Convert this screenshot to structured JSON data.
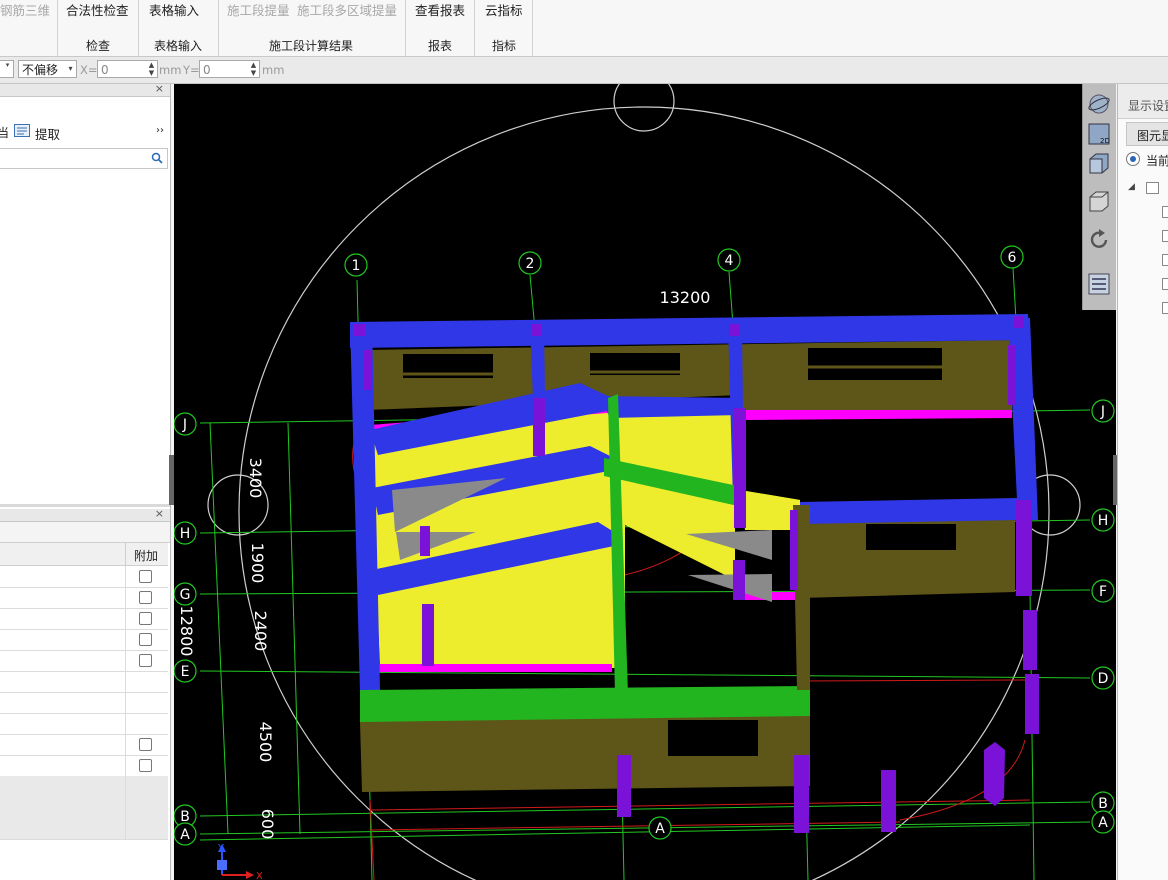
{
  "ribbon": {
    "cut_left": "钢筋三维",
    "groups": [
      {
        "buttons": [
          "合法性检查"
        ],
        "label": "检查"
      },
      {
        "buttons": [
          "表格输入"
        ],
        "label": "表格输入"
      },
      {
        "buttons": [
          "施工段提量",
          "施工段多区域提量"
        ],
        "label": "施工段计算结果"
      },
      {
        "buttons": [
          "查看报表"
        ],
        "label": "报表"
      },
      {
        "buttons": [
          "云指标"
        ],
        "label": "指标"
      }
    ]
  },
  "toolbar": {
    "offset_select": "不偏移",
    "x_label": "X=",
    "x_value": "0",
    "x_unit": "mm",
    "y_label": "Y=",
    "y_value": "0",
    "y_unit": "mm"
  },
  "left_panel": {
    "top_toolbar": {
      "cut_label": "当",
      "extract_label": "提取",
      "more": "››"
    },
    "search_placeholder": "",
    "close": "×",
    "bottom_grid": {
      "header_extra": "附加",
      "checkbox_rows": [
        true,
        true,
        true,
        true,
        true,
        false,
        false,
        false,
        true,
        true,
        false,
        false,
        false
      ]
    }
  },
  "viewport": {
    "axes_top": [
      "1",
      "2",
      "4",
      "6"
    ],
    "axes_right": [
      "J",
      "H",
      "F",
      "D",
      "B",
      "A"
    ],
    "axes_left": [
      "J",
      "H",
      "G",
      "E",
      "B",
      "A"
    ],
    "axis_bottom": "A",
    "dim_top": "13200",
    "dims_left": [
      "3400",
      "1900",
      "2400",
      "4500",
      "600"
    ],
    "dim_total_left": "12800",
    "triad_x": "X",
    "triad_y": "Y",
    "colors": {
      "beam": "#2f37e6",
      "slab": "#eded2e",
      "wall": "#5e5518",
      "column": "#7a12d8",
      "green": "#22b51f",
      "magenta": "#f0f",
      "grid": "#26d026"
    }
  },
  "view_tools": [
    "orbit-icon",
    "2d-view-icon",
    "3d-view-icon",
    "box-view-icon",
    "rotate-icon",
    "layer-settings-icon"
  ],
  "right_panel": {
    "title": "显示设置",
    "tab": "图元显示",
    "radio_label": "当前",
    "tree_checks": 5
  }
}
